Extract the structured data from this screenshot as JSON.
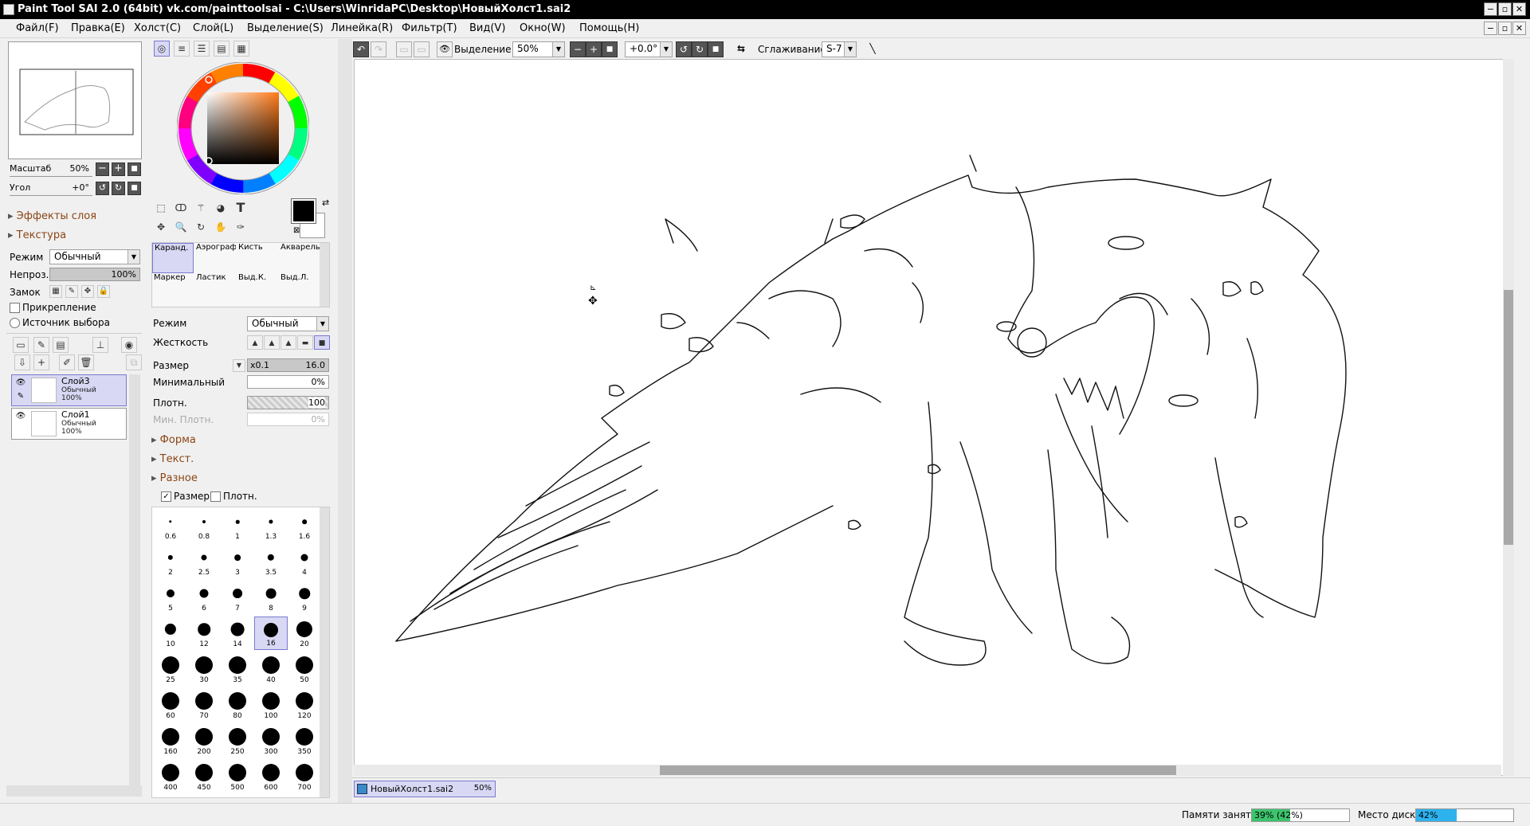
{
  "window": {
    "title": "Paint Tool SAI 2.0 (64bit) vk.com/painttoolsai - C:\\Users\\WinridaPC\\Desktop\\НовыйХолст1.sai2",
    "minimize": "−",
    "restore": "▫",
    "close": "✕"
  },
  "menu": [
    "Файл(F)",
    "Правка(E)",
    "Холст(C)",
    "Слой(L)",
    "Выделение(S)",
    "Линейка(R)",
    "Фильтр(T)",
    "Вид(V)",
    "Окно(W)",
    "Помощь(H)"
  ],
  "navigator": {
    "zoom_label": "Масштаб",
    "zoom_value": "50%",
    "angle_label": "Угол",
    "angle_value": "+0°"
  },
  "layer_panel": {
    "effects_label": "Эффекты слоя",
    "texture_label": "Текстура",
    "mode_label": "Режим",
    "mode_value": "Обычный",
    "opacity_label": "Непроз.",
    "opacity_value": "100%",
    "lock_label": "Замок",
    "clip_label": "Прикрепление",
    "source_label": "Источник выбора",
    "layers": [
      {
        "name": "Слой3",
        "mode": "Обычный",
        "opacity": "100%",
        "selected": true
      },
      {
        "name": "Слой1",
        "mode": "Обычный",
        "opacity": "100%",
        "selected": false
      }
    ]
  },
  "tool_panel": {
    "brushes": [
      "Каранд.",
      "Аэрограф",
      "Кисть",
      "Акварель",
      "Маркер",
      "Ластик",
      "Выд.К.",
      "Выд.Л."
    ],
    "mode_label": "Режим",
    "mode_value": "Обычный",
    "hardness_label": "Жесткость",
    "size_label": "Размер",
    "size_mult": "x0.1",
    "size_value": "16.0",
    "min_label": "Минимальный",
    "min_value": "0%",
    "density_label": "Плотн.",
    "density_value": "100",
    "min_density_label": "Мин. Плотн.",
    "min_density_value": "0%",
    "shape_label": "Форма",
    "texture_label": "Текст.",
    "misc_label": "Разное",
    "size_check_label": "Размер",
    "density_check_label": "Плотн.",
    "brush_sizes": [
      "0.6",
      "0.8",
      "1",
      "1.3",
      "1.6",
      "2",
      "2.5",
      "3",
      "3.5",
      "4",
      "5",
      "6",
      "7",
      "8",
      "9",
      "10",
      "12",
      "14",
      "16",
      "20",
      "25",
      "30",
      "35",
      "40",
      "50",
      "60",
      "70",
      "80",
      "100",
      "120",
      "160",
      "200",
      "250",
      "300",
      "350",
      "400",
      "450",
      "500",
      "600",
      "700"
    ],
    "selected_size": "16"
  },
  "toolbar": {
    "selection_label": "Выделение",
    "zoom_value": "50%",
    "rotation_value": "+0.0°",
    "smoothing_label": "Сглаживание",
    "smoothing_value": "S-7"
  },
  "document_tab": {
    "name": "НовыйХолст1.sai2",
    "zoom": "50%"
  },
  "status_bar": {
    "memory_label": "Памяти занято",
    "memory_value": "39% (42%)",
    "memory_fraction": 0.39,
    "disk_label": "Место диска",
    "disk_value": "42%",
    "disk_fraction": 0.42
  },
  "colors": {
    "primary": "#000000",
    "secondary": "#ffffff",
    "selection_highlight": "#d8d8f4",
    "memory_fill": "#3ec46d",
    "disk_fill": "#2eb2ee"
  }
}
